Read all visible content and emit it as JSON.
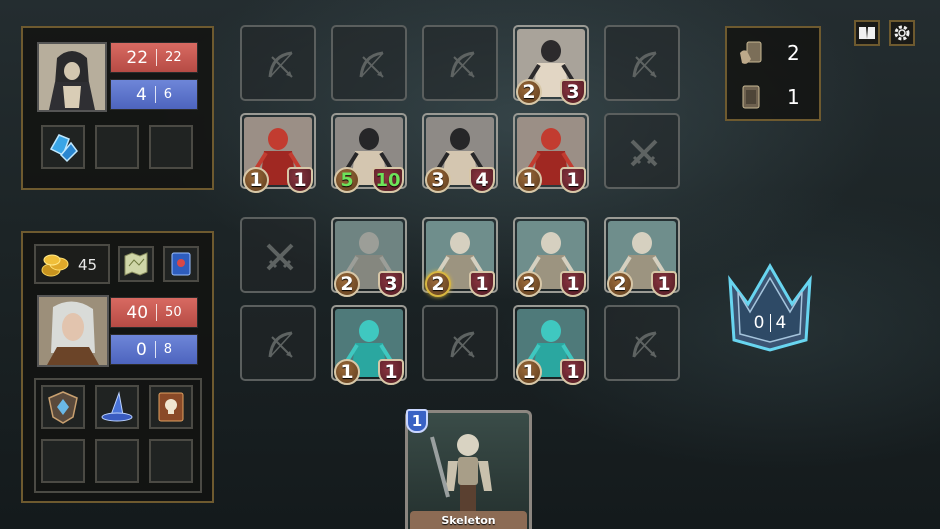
{
  "enemy": {
    "hp": {
      "current": "22",
      "max": "22"
    },
    "mana": {
      "current": "4",
      "max": "6"
    },
    "portrait_icon": "hooded-dark-knight-portrait",
    "items": [
      {
        "icon": "blue-crystal-shard-icon"
      },
      {
        "icon": "empty-slot"
      },
      {
        "icon": "empty-slot"
      }
    ]
  },
  "deck_counter": {
    "hand_count": "2",
    "deck_count": "1"
  },
  "player": {
    "gold": "45",
    "hp": {
      "current": "40",
      "max": "50"
    },
    "mana": {
      "current": "0",
      "max": "8"
    },
    "portrait_icon": "silver-haired-elf-portrait",
    "consumables": [
      {
        "icon": "treasure-map-icon"
      },
      {
        "icon": "blue-spellbook-icon"
      }
    ],
    "equipment": [
      {
        "icon": "crystal-shield-icon"
      },
      {
        "icon": "wizard-hat-icon"
      },
      {
        "icon": "skull-tome-icon"
      },
      {
        "icon": "empty-slot"
      },
      {
        "icon": "empty-slot"
      },
      {
        "icon": "empty-slot"
      }
    ]
  },
  "board": {
    "enemy_back_row": [
      {
        "empty": true,
        "icon": "bow-icon"
      },
      {
        "empty": true,
        "icon": "bow-icon"
      },
      {
        "empty": true,
        "icon": "bow-icon"
      },
      {
        "empty": false,
        "creature": "hooded-priestess",
        "attack": "2",
        "health": "3"
      },
      {
        "empty": true,
        "icon": "bow-icon"
      }
    ],
    "enemy_front_row": [
      {
        "empty": false,
        "creature": "red-demon",
        "attack": "1",
        "health": "1"
      },
      {
        "empty": false,
        "creature": "dark-knight",
        "attack": "5",
        "health": "10",
        "attack_buffed": true,
        "health_buffed": true
      },
      {
        "empty": false,
        "creature": "dark-knight",
        "attack": "3",
        "health": "4"
      },
      {
        "empty": false,
        "creature": "red-demon",
        "attack": "1",
        "health": "1"
      },
      {
        "empty": true,
        "icon": "crossed-swords-icon"
      }
    ],
    "player_front_row": [
      {
        "empty": true,
        "icon": "crossed-swords-icon"
      },
      {
        "empty": false,
        "creature": "troll",
        "attack": "2",
        "health": "3"
      },
      {
        "empty": false,
        "creature": "skeleton",
        "attack": "2",
        "health": "1",
        "highlighted": true
      },
      {
        "empty": false,
        "creature": "skeleton",
        "attack": "2",
        "health": "1"
      },
      {
        "empty": false,
        "creature": "skeleton",
        "attack": "2",
        "health": "1"
      }
    ],
    "player_back_row": [
      {
        "empty": true,
        "icon": "bow-icon"
      },
      {
        "empty": false,
        "creature": "spectral-ghoul",
        "attack": "1",
        "health": "1"
      },
      {
        "empty": true,
        "icon": "bow-icon"
      },
      {
        "empty": false,
        "creature": "spectral-ghoul",
        "attack": "1",
        "health": "1"
      },
      {
        "empty": true,
        "icon": "bow-icon"
      }
    ]
  },
  "crown": {
    "current": "0",
    "max": "4"
  },
  "hand_card": {
    "name": "Skeleton",
    "cost": "1"
  },
  "top_buttons": [
    {
      "icon": "book-icon"
    },
    {
      "icon": "gear-icon"
    }
  ],
  "colors": {
    "hp": "#c4564f",
    "mana": "#5b72cc",
    "panel_border": "#6e5a2f",
    "crown": "#4fa8c8"
  }
}
